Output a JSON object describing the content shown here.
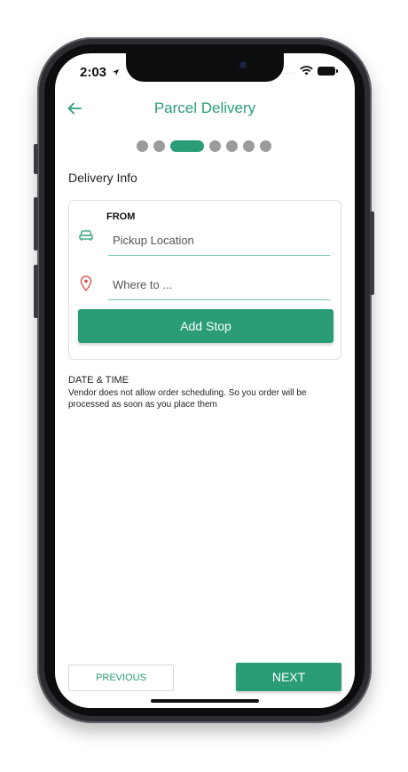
{
  "status_bar": {
    "time": "2:03",
    "signal_dots": "....",
    "icons": [
      "location-arrow-icon",
      "wifi-icon",
      "battery-icon"
    ]
  },
  "header": {
    "title": "Parcel Delivery",
    "back_icon": "arrow-left-icon"
  },
  "stepper": {
    "total_steps": 7,
    "current_step": 3
  },
  "delivery_info": {
    "section_title": "Delivery Info",
    "from_label": "FROM",
    "pickup_placeholder": "Pickup Location",
    "destination_placeholder": "Where to ...",
    "pickup_icon": "car-icon",
    "destination_icon": "map-pin-icon",
    "add_stop_label": "Add Stop"
  },
  "date_time": {
    "title": "DATE & TIME",
    "note": "Vendor does not allow order scheduling. So you order will be processed as soon as you place them"
  },
  "footer": {
    "previous_label": "PREVIOUS",
    "next_label": "NEXT"
  },
  "colors": {
    "accent": "#2a9d78",
    "pin": "#e04545",
    "dot_inactive": "#9b9b9b"
  }
}
